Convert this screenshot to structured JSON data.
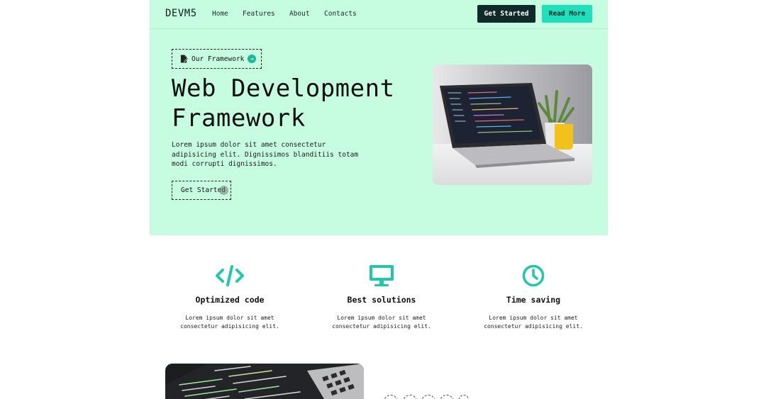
{
  "colors": {
    "hero_bg": "#c6fde1",
    "accent": "#1de0bd",
    "dark": "#0f2a2a",
    "icon": "#1dc9a9"
  },
  "nav": {
    "logo": "DEVM5",
    "links": [
      "Home",
      "Features",
      "About",
      "Contacts"
    ],
    "primary_button": "Get Started",
    "secondary_button": "Read More"
  },
  "hero": {
    "badge_label": "Our Framework",
    "badge_icons": [
      "document-edit-icon",
      "arrow-right-circle-icon"
    ],
    "title_line1": "Web Development",
    "title_line2": "Framework",
    "description": "Lorem ipsum dolor sit amet consectetur adipisicing elit. Dignissimos blanditiis totam modi corrupti dignissimos.",
    "cta": "Get Started"
  },
  "features": [
    {
      "icon": "code-icon",
      "title": "Optimized code",
      "text": "Lorem ipsum dolor sit amet consectetur adipisicing elit."
    },
    {
      "icon": "monitor-icon",
      "title": "Best solutions",
      "text": "Lorem ipsum dolor sit amet consectetur adipisicing elit."
    },
    {
      "icon": "clock-icon",
      "title": "Time saving",
      "text": "Lorem ipsum dolor sit amet consectetur adipisicing elit."
    }
  ]
}
